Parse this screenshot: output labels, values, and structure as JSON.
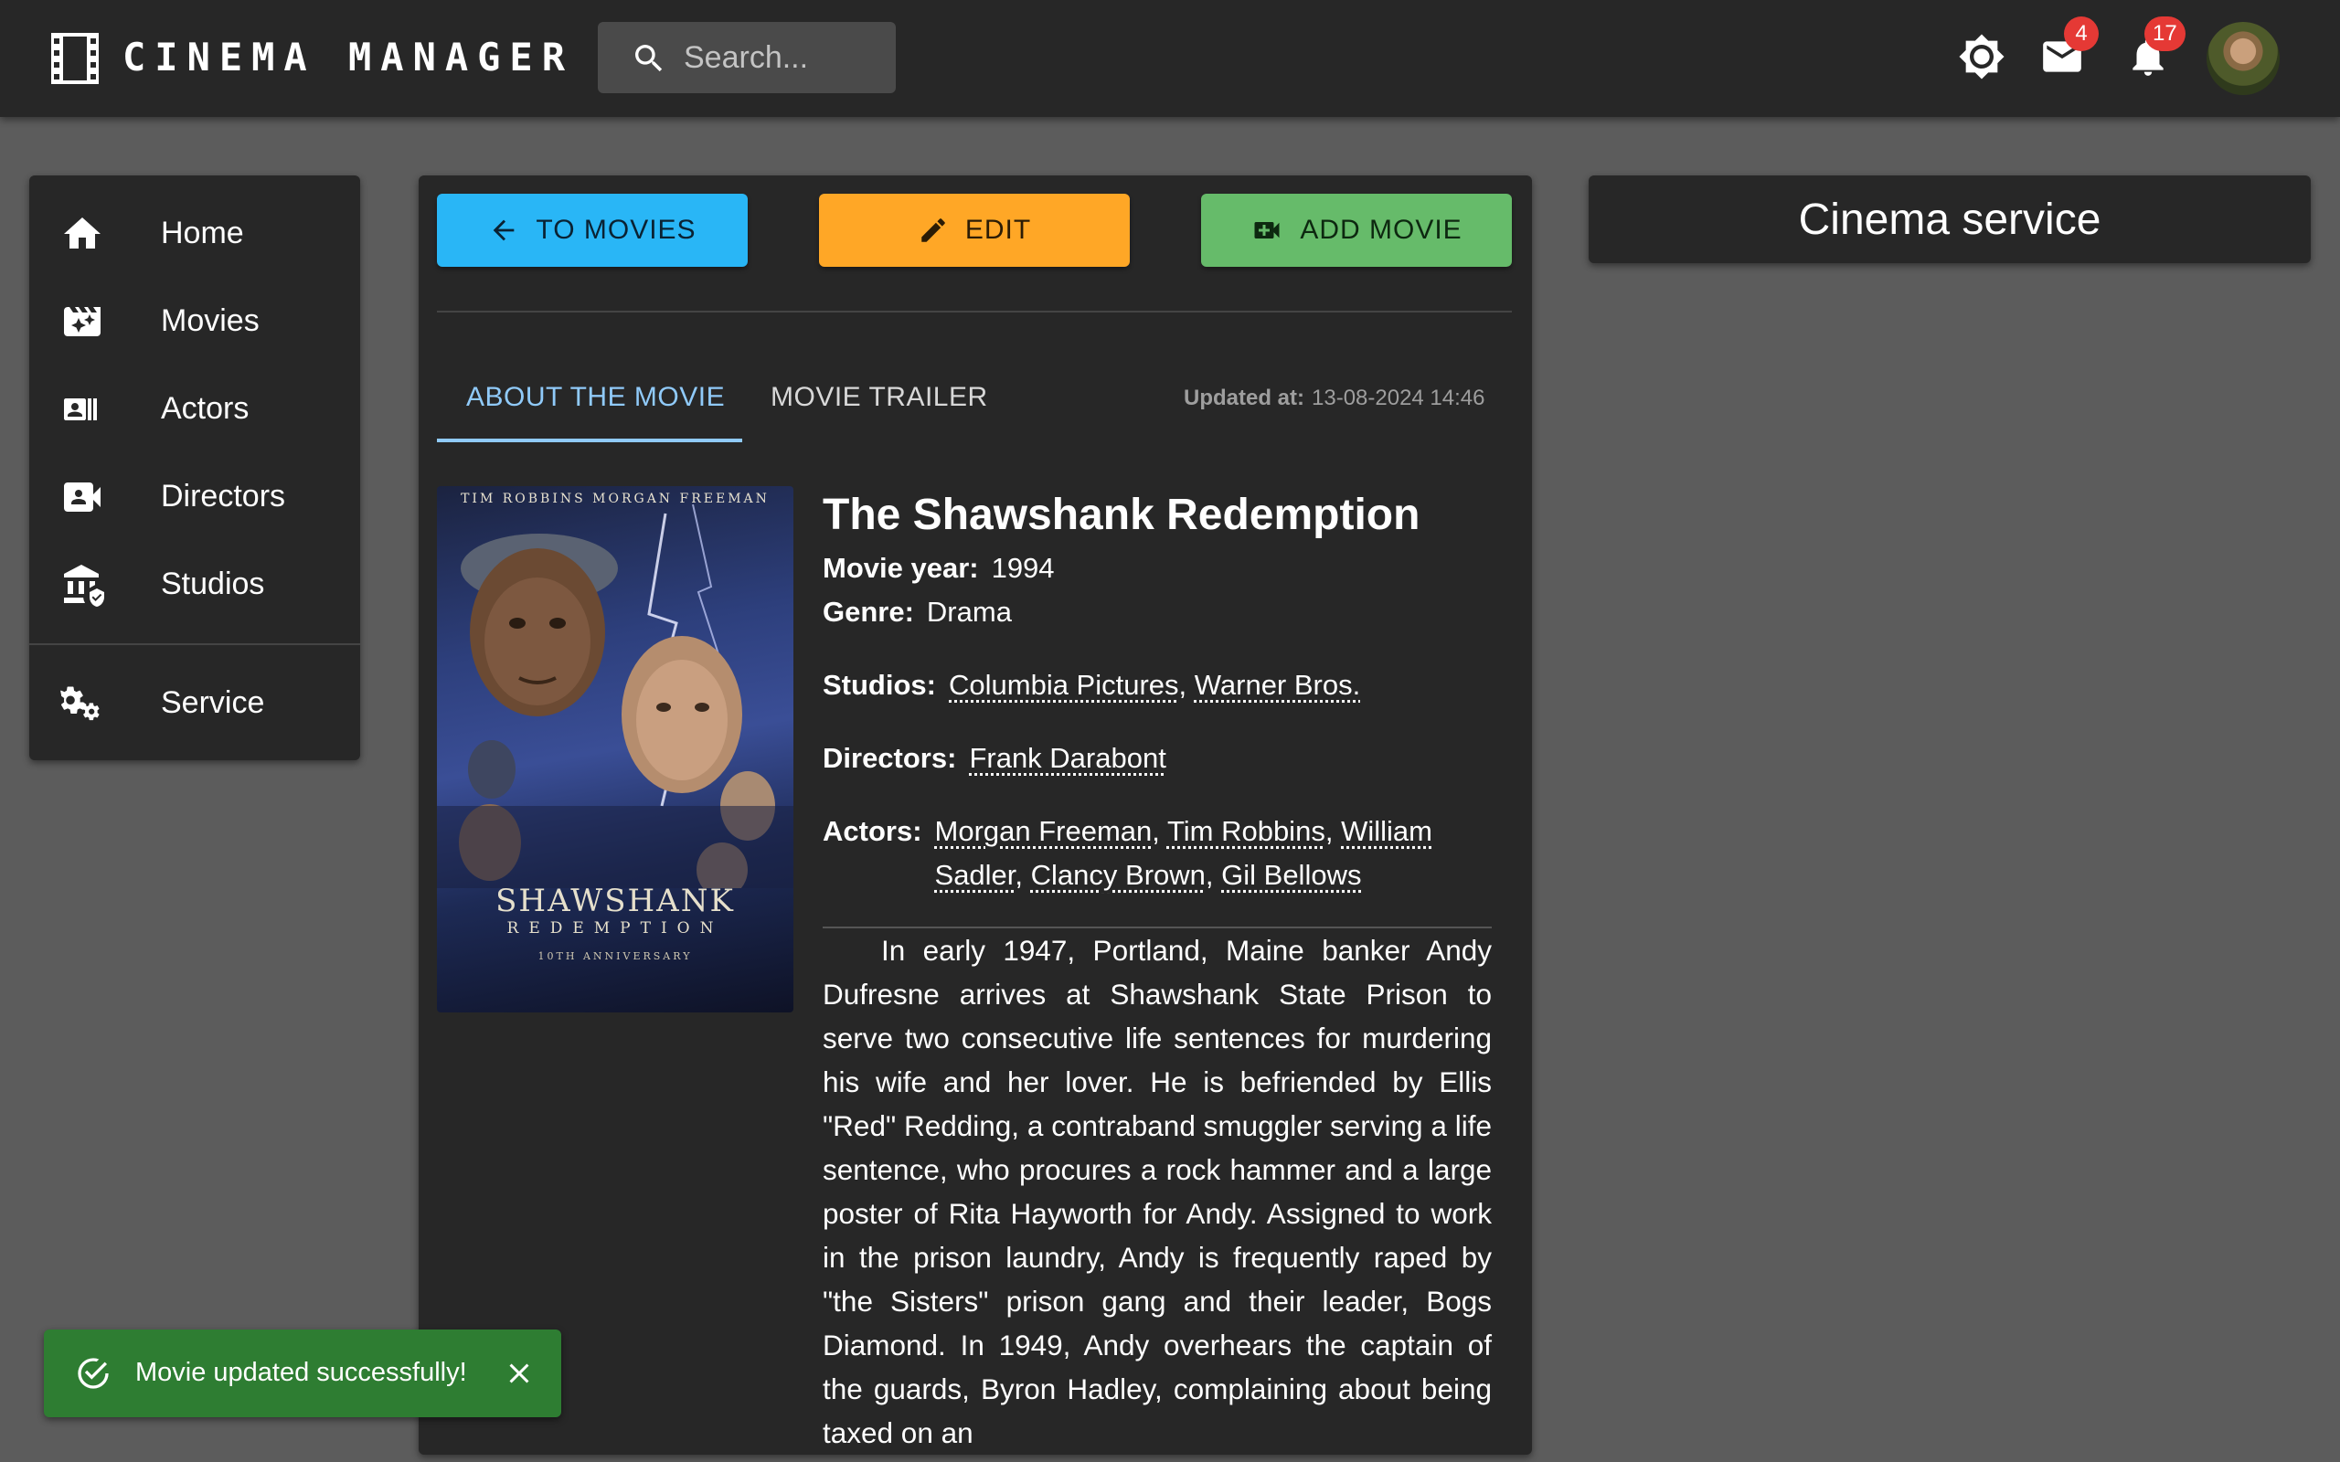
{
  "app": {
    "title": "CINEMA MANAGER"
  },
  "search": {
    "placeholder": "Search..."
  },
  "header": {
    "icons": [
      "settings-icon",
      "mail-icon",
      "notifications-icon"
    ],
    "mail_count": "4",
    "notifications_count": "17",
    "badge_color": "#e53935"
  },
  "sidebar": {
    "items": [
      {
        "label": "Home",
        "icon": "home-icon"
      },
      {
        "label": "Movies",
        "icon": "movies-icon"
      },
      {
        "label": "Actors",
        "icon": "actors-icon"
      },
      {
        "label": "Directors",
        "icon": "directors-icon"
      },
      {
        "label": "Studios",
        "icon": "studios-icon"
      },
      {
        "label": "Service",
        "icon": "service-icon"
      }
    ]
  },
  "toolbar": {
    "back_label": "TO MOVIES",
    "edit_label": "EDIT",
    "add_label": "ADD MOVIE",
    "colors": {
      "back": "#29b6f6",
      "edit": "#ffa726",
      "add": "#66bb6a"
    }
  },
  "tabs": {
    "items": [
      {
        "label": "ABOUT THE MOVIE",
        "active": true
      },
      {
        "label": "MOVIE TRAILER",
        "active": false
      }
    ],
    "accent": "#90caf9"
  },
  "updated": {
    "label": "Updated at:",
    "value": "13-08-2024 14:46"
  },
  "poster": {
    "top_names": "TIM ROBBINS    MORGAN FREEMAN",
    "title_line": "SHAWSHANK",
    "sub_line": "REDEMPTION",
    "anniversary": "10TH ANNIVERSARY"
  },
  "movie": {
    "title": "The Shawshank Redemption",
    "year_label": "Movie year:",
    "year": "1994",
    "genre_label": "Genre:",
    "genre": "Drama",
    "studios_label": "Studios:",
    "studios": [
      "Columbia Pictures",
      "Warner Bros."
    ],
    "directors_label": "Directors:",
    "directors": [
      "Frank Darabont"
    ],
    "actors_label": "Actors:",
    "actors": [
      "Morgan Freeman",
      "Tim Robbins",
      "William Sadler",
      "Clancy Brown",
      "Gil Bellows"
    ],
    "description": "In early 1947, Portland, Maine banker Andy Dufresne arrives at Shawshank State Prison to serve two consecutive life sentences for murdering his wife and her lover. He is befriended by Ellis \"Red\" Redding, a contraband smuggler serving a life sentence, who procures a rock hammer and a large poster of Rita Hayworth for Andy. Assigned to work in the prison laundry, Andy is frequently raped by \"the Sisters\" prison gang and their leader, Bogs Diamond. In 1949, Andy overhears the captain of the guards, Byron Hadley, complaining about being taxed on an"
  },
  "right_panel": {
    "title": "Cinema service"
  },
  "snackbar": {
    "message": "Movie updated successfully!",
    "color": "#2e7d32"
  }
}
